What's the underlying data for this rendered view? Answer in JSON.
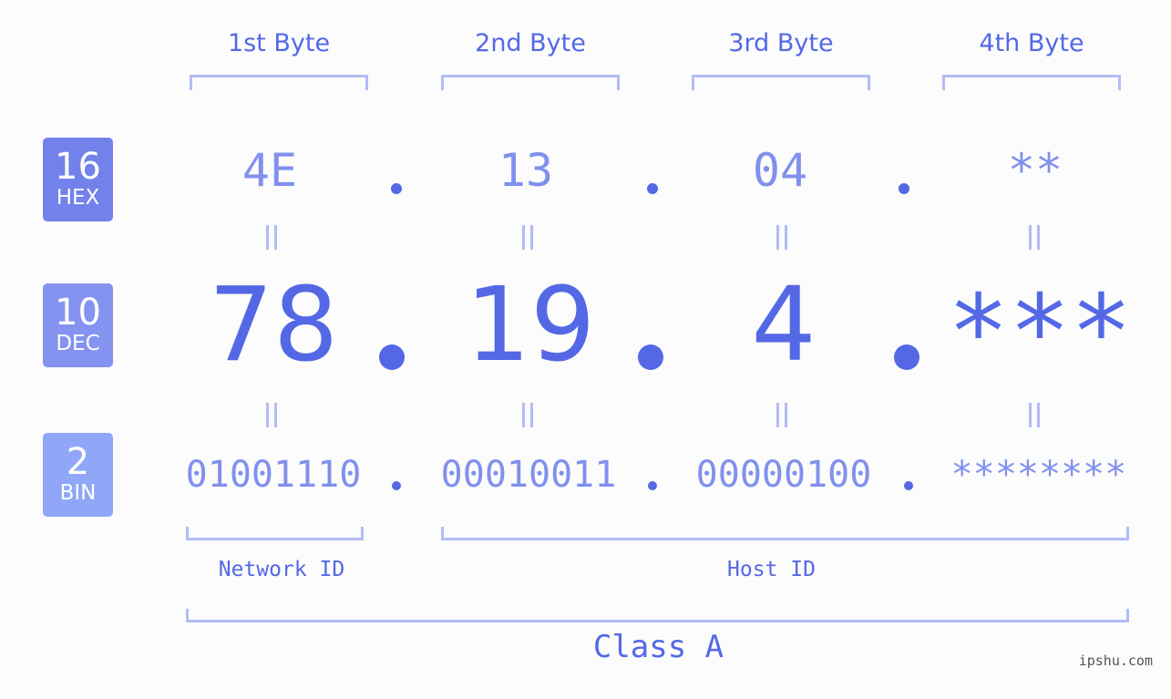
{
  "bytes": {
    "headers": [
      "1st Byte",
      "2nd Byte",
      "3rd Byte",
      "4th Byte"
    ]
  },
  "badges": {
    "hex": {
      "base": "16",
      "label": "HEX",
      "color": "#7381ea"
    },
    "dec": {
      "base": "10",
      "label": "DEC",
      "color": "#8493f0"
    },
    "bin": {
      "base": "2",
      "label": "BIN",
      "color": "#90a7f8"
    }
  },
  "hex_values": [
    "4E",
    "13",
    "04",
    "**"
  ],
  "dec_values": [
    "78",
    "19",
    "4",
    "***"
  ],
  "bin_values": [
    "01001110",
    "00010011",
    "00000100",
    "********"
  ],
  "separator": ".",
  "segments": {
    "network": "Network ID",
    "host": "Host ID"
  },
  "ip_class": "Class A",
  "watermark": "ipshu.com",
  "colors": {
    "accent": "#5468e6",
    "light_accent": "#8190ee",
    "bracket": "#b3bcf5"
  }
}
